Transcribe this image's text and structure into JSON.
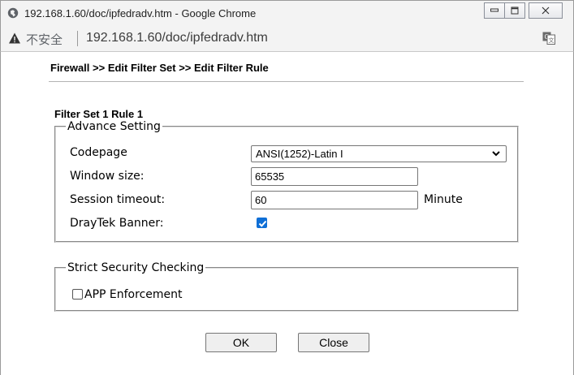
{
  "window": {
    "title": "192.168.1.60/doc/ipfedradv.htm - Google Chrome"
  },
  "addressbar": {
    "security_label": "不安全",
    "url": "192.168.1.60/doc/ipfedradv.htm"
  },
  "page": {
    "breadcrumb": "Firewall >> Edit Filter Set >> Edit Filter Rule",
    "subtitle": "Filter Set 1 Rule 1"
  },
  "advance": {
    "legend": "Advance Setting",
    "codepage_label": "Codepage",
    "codepage_value": "ANSI(1252)-Latin I",
    "window_size_label": "Window size:",
    "window_size_value": "65535",
    "session_timeout_label": "Session timeout:",
    "session_timeout_value": "60",
    "session_timeout_unit": "Minute",
    "banner_label": "DrayTek Banner:",
    "banner_checked": true
  },
  "strict": {
    "legend": "Strict Security Checking",
    "app_enforcement_label": "APP Enforcement",
    "app_enforcement_checked": false
  },
  "buttons": {
    "ok": "OK",
    "close": "Close"
  },
  "colors": {
    "checkbox_accent": "#0f6fd6",
    "titlebar": "#f3f3f3"
  }
}
